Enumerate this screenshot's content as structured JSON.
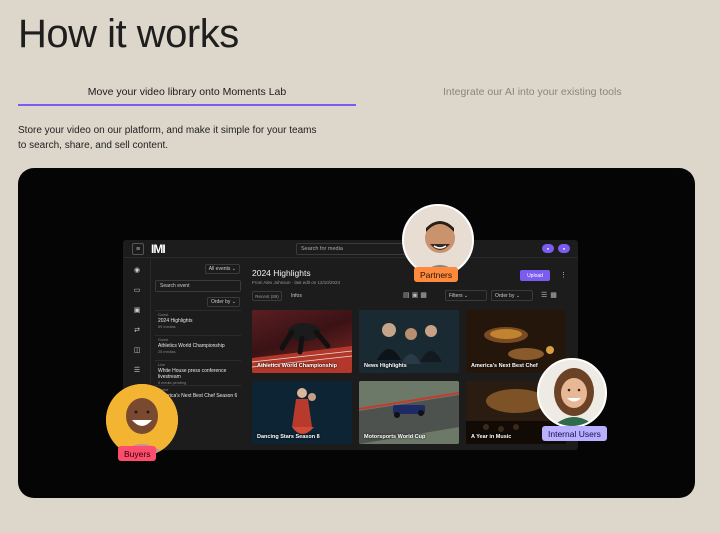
{
  "page": {
    "heading": "How it works"
  },
  "tabs": [
    {
      "label": "Move your video library onto Moments Lab",
      "active": true
    },
    {
      "label": "Integrate our AI into your existing tools",
      "active": false
    }
  ],
  "description": "Store your video on our platform, and make it simple for your teams to search, share, and sell content.",
  "colors": {
    "accent": "#7b5cf0",
    "background": "#ddd6cb",
    "stage": "#050505",
    "partners_badge": "#ff8a3d",
    "buyers_badge": "#ff4d6d",
    "internal_badge": "#b9b0ff"
  },
  "app": {
    "logo": "IMI",
    "search_placeholder": "Search for media",
    "rail_icons": [
      "home-icon",
      "folder-icon",
      "monitor-icon",
      "shuffle-icon",
      "book-icon",
      "list-icon"
    ],
    "events": {
      "filter_label": "All events ⌄",
      "search_placeholder": "Search event",
      "order_label": "Order by ⌄",
      "items": [
        {
          "who": "Guest",
          "title": "2024 Highlights",
          "count": "89 medias"
        },
        {
          "who": "Guest",
          "title": "Athletics World Championship",
          "count": "25 medias"
        },
        {
          "who": "Live",
          "title": "White House press conference livestream",
          "count": "5 media pending"
        },
        {
          "who": "Guest",
          "title": "America's Next Best Chef Season 6",
          "count": ""
        }
      ]
    },
    "main": {
      "title": "2024 Highlights",
      "subtitle": "From Alex Johnson · last edit on 12/10/2024",
      "upload_label": "Upload",
      "chip_recent": "Recent (89)",
      "chip_infos": "Infos",
      "filters_label": "Filters ⌄",
      "order_label": "Order by ⌄",
      "cards": [
        {
          "label": "Athletics World Championship"
        },
        {
          "label": "News Highlights"
        },
        {
          "label": "America's Next Best Chef"
        },
        {
          "label": "Dancing Stars Season 8"
        },
        {
          "label": "Motorsports World Cup"
        },
        {
          "label": "A Year in Music"
        }
      ]
    }
  },
  "badges": {
    "partners": "Partners",
    "buyers": "Buyers",
    "internal": "Internal Users"
  }
}
